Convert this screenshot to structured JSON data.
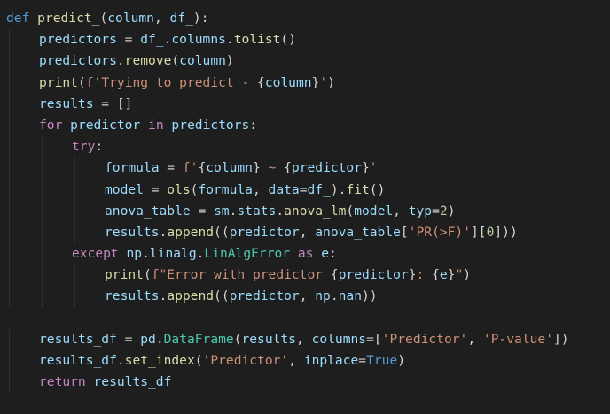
{
  "code": {
    "lines": [
      {
        "indent": 0,
        "tokens": [
          [
            "kw",
            "def"
          ],
          [
            "plain",
            " "
          ],
          [
            "fn",
            "predict_"
          ],
          [
            "op",
            "("
          ],
          [
            "var",
            "column"
          ],
          [
            "op",
            ", "
          ],
          [
            "var",
            "df_"
          ],
          [
            "op",
            "):"
          ]
        ]
      },
      {
        "indent": 1,
        "tokens": [
          [
            "var",
            "predictors"
          ],
          [
            "op",
            " = "
          ],
          [
            "var",
            "df_"
          ],
          [
            "op",
            "."
          ],
          [
            "var",
            "columns"
          ],
          [
            "op",
            "."
          ],
          [
            "fn",
            "tolist"
          ],
          [
            "op",
            "()"
          ]
        ]
      },
      {
        "indent": 1,
        "tokens": [
          [
            "var",
            "predictors"
          ],
          [
            "op",
            "."
          ],
          [
            "fn",
            "remove"
          ],
          [
            "op",
            "("
          ],
          [
            "var",
            "column"
          ],
          [
            "op",
            ")"
          ]
        ]
      },
      {
        "indent": 1,
        "tokens": [
          [
            "fn",
            "print"
          ],
          [
            "op",
            "("
          ],
          [
            "str",
            "f'Trying to predict - "
          ],
          [
            "op",
            "{"
          ],
          [
            "var",
            "column"
          ],
          [
            "op",
            "}"
          ],
          [
            "str",
            "'"
          ],
          [
            "op",
            ")"
          ]
        ]
      },
      {
        "indent": 1,
        "tokens": [
          [
            "var",
            "results"
          ],
          [
            "op",
            " = []"
          ]
        ]
      },
      {
        "indent": 1,
        "tokens": [
          [
            "ctl",
            "for"
          ],
          [
            "plain",
            " "
          ],
          [
            "var",
            "predictor"
          ],
          [
            "plain",
            " "
          ],
          [
            "ctl",
            "in"
          ],
          [
            "plain",
            " "
          ],
          [
            "var",
            "predictors"
          ],
          [
            "op",
            ":"
          ]
        ]
      },
      {
        "indent": 2,
        "tokens": [
          [
            "ctl",
            "try"
          ],
          [
            "op",
            ":"
          ]
        ]
      },
      {
        "indent": 3,
        "tokens": [
          [
            "var",
            "formula"
          ],
          [
            "op",
            " = "
          ],
          [
            "str",
            "f'"
          ],
          [
            "op",
            "{"
          ],
          [
            "var",
            "column"
          ],
          [
            "op",
            "}"
          ],
          [
            "str",
            " ~ "
          ],
          [
            "op",
            "{"
          ],
          [
            "var",
            "predictor"
          ],
          [
            "op",
            "}"
          ],
          [
            "str",
            "'"
          ]
        ]
      },
      {
        "indent": 3,
        "tokens": [
          [
            "var",
            "model"
          ],
          [
            "op",
            " = "
          ],
          [
            "fn",
            "ols"
          ],
          [
            "op",
            "("
          ],
          [
            "var",
            "formula"
          ],
          [
            "op",
            ", "
          ],
          [
            "var",
            "data"
          ],
          [
            "op",
            "="
          ],
          [
            "var",
            "df_"
          ],
          [
            "op",
            ")."
          ],
          [
            "fn",
            "fit"
          ],
          [
            "op",
            "()"
          ]
        ]
      },
      {
        "indent": 3,
        "tokens": [
          [
            "var",
            "anova_table"
          ],
          [
            "op",
            " = "
          ],
          [
            "var",
            "sm"
          ],
          [
            "op",
            "."
          ],
          [
            "var",
            "stats"
          ],
          [
            "op",
            "."
          ],
          [
            "fn",
            "anova_lm"
          ],
          [
            "op",
            "("
          ],
          [
            "var",
            "model"
          ],
          [
            "op",
            ", "
          ],
          [
            "var",
            "typ"
          ],
          [
            "op",
            "="
          ],
          [
            "num",
            "2"
          ],
          [
            "op",
            ")"
          ]
        ]
      },
      {
        "indent": 3,
        "tokens": [
          [
            "var",
            "results"
          ],
          [
            "op",
            "."
          ],
          [
            "fn",
            "append"
          ],
          [
            "op",
            "(("
          ],
          [
            "var",
            "predictor"
          ],
          [
            "op",
            ", "
          ],
          [
            "var",
            "anova_table"
          ],
          [
            "op",
            "["
          ],
          [
            "str",
            "'PR(>F)'"
          ],
          [
            "op",
            "]["
          ],
          [
            "num",
            "0"
          ],
          [
            "op",
            "]))"
          ]
        ]
      },
      {
        "indent": 2,
        "tokens": [
          [
            "ctl",
            "except"
          ],
          [
            "plain",
            " "
          ],
          [
            "var",
            "np"
          ],
          [
            "op",
            "."
          ],
          [
            "var",
            "linalg"
          ],
          [
            "op",
            "."
          ],
          [
            "cls",
            "LinAlgError"
          ],
          [
            "plain",
            " "
          ],
          [
            "ctl",
            "as"
          ],
          [
            "plain",
            " "
          ],
          [
            "var",
            "e"
          ],
          [
            "op",
            ":"
          ]
        ]
      },
      {
        "indent": 3,
        "tokens": [
          [
            "fn",
            "print"
          ],
          [
            "op",
            "("
          ],
          [
            "str",
            "f\"Error with predictor "
          ],
          [
            "op",
            "{"
          ],
          [
            "var",
            "predictor"
          ],
          [
            "op",
            "}"
          ],
          [
            "str",
            ": "
          ],
          [
            "op",
            "{"
          ],
          [
            "var",
            "e"
          ],
          [
            "op",
            "}"
          ],
          [
            "str",
            "\""
          ],
          [
            "op",
            ")"
          ]
        ]
      },
      {
        "indent": 3,
        "tokens": [
          [
            "var",
            "results"
          ],
          [
            "op",
            "."
          ],
          [
            "fn",
            "append"
          ],
          [
            "op",
            "(("
          ],
          [
            "var",
            "predictor"
          ],
          [
            "op",
            ", "
          ],
          [
            "var",
            "np"
          ],
          [
            "op",
            "."
          ],
          [
            "var",
            "nan"
          ],
          [
            "op",
            "))"
          ]
        ]
      },
      {
        "indent": 0,
        "tokens": []
      },
      {
        "indent": 1,
        "tokens": [
          [
            "var",
            "results_df"
          ],
          [
            "op",
            " = "
          ],
          [
            "var",
            "pd"
          ],
          [
            "op",
            "."
          ],
          [
            "cls",
            "DataFrame"
          ],
          [
            "op",
            "("
          ],
          [
            "var",
            "results"
          ],
          [
            "op",
            ", "
          ],
          [
            "var",
            "columns"
          ],
          [
            "op",
            "=["
          ],
          [
            "str",
            "'Predictor'"
          ],
          [
            "op",
            ", "
          ],
          [
            "str",
            "'P-value'"
          ],
          [
            "op",
            "])"
          ]
        ]
      },
      {
        "indent": 1,
        "tokens": [
          [
            "var",
            "results_df"
          ],
          [
            "op",
            "."
          ],
          [
            "fn",
            "set_index"
          ],
          [
            "op",
            "("
          ],
          [
            "str",
            "'Predictor'"
          ],
          [
            "op",
            ", "
          ],
          [
            "var",
            "inplace"
          ],
          [
            "op",
            "="
          ],
          [
            "bool",
            "True"
          ],
          [
            "op",
            ")"
          ]
        ]
      },
      {
        "indent": 1,
        "tokens": [
          [
            "ctl",
            "return"
          ],
          [
            "plain",
            " "
          ],
          [
            "var",
            "results_df"
          ]
        ]
      }
    ]
  }
}
